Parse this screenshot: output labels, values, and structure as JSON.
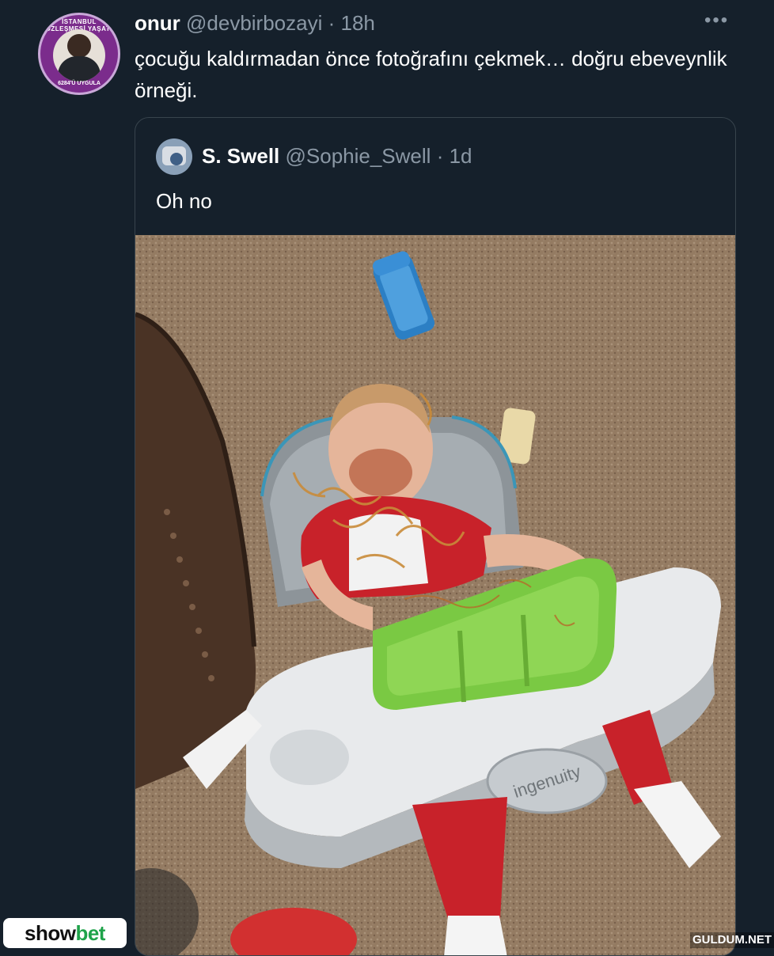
{
  "tweet": {
    "author_name": "onur",
    "handle": "@devbirbozayi",
    "separator": "·",
    "time": "18h",
    "text": "çocuğu kaldırmadan önce fotoğrafını çekmek… doğru ebeveynlik örneği.",
    "more_icon": "more-horizontal-icon"
  },
  "quoted_tweet": {
    "author_name": "S. Swell",
    "handle": "@Sophie_Swell",
    "separator": "·",
    "time": "1d",
    "text": "Oh no",
    "photo_label": "ingenuity"
  },
  "overlays": {
    "brand_logo_part1": "show",
    "brand_logo_part2": "bet",
    "watermark": "GULDUM.NET"
  },
  "colors": {
    "background": "#15202b",
    "secondary_text": "#8b98a5",
    "border": "#38444d"
  }
}
